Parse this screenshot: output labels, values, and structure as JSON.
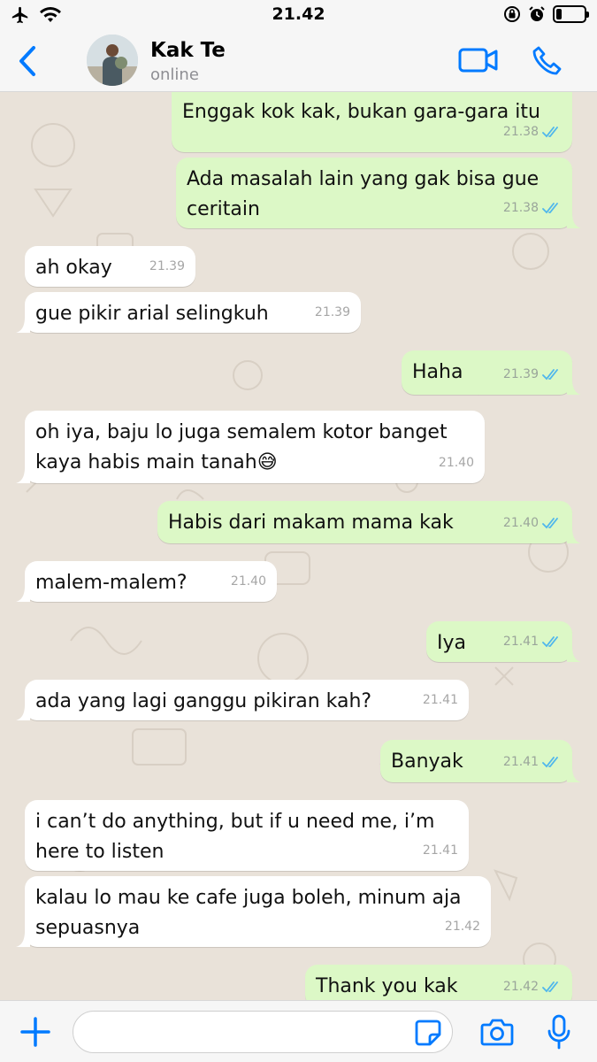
{
  "status_bar": {
    "time": "21.42",
    "battery_level": 0.2
  },
  "header": {
    "contact_name": "Kak Te",
    "contact_status": "online"
  },
  "messages": [
    {
      "direction": "out",
      "text": "Enggak kok kak, bukan gara-gara itu",
      "time": "21.38",
      "read": true
    },
    {
      "direction": "out",
      "text": "Ada masalah lain yang gak bisa gue\nceritain",
      "time": "21.38",
      "read": true
    },
    {
      "direction": "in",
      "text": "ah okay",
      "time": "21.39"
    },
    {
      "direction": "in",
      "text": "gue pikir arial selingkuh",
      "time": "21.39"
    },
    {
      "direction": "out",
      "text": "Haha",
      "time": "21.39",
      "read": true
    },
    {
      "direction": "in",
      "text": "oh iya, baju lo juga semalem kotor banget\nkaya habis main tanah😅",
      "time": "21.40"
    },
    {
      "direction": "out",
      "text": "Habis dari makam mama kak",
      "time": "21.40",
      "read": true
    },
    {
      "direction": "in",
      "text": "malem-malem?",
      "time": "21.40"
    },
    {
      "direction": "out",
      "text": "Iya",
      "time": "21.41",
      "read": true
    },
    {
      "direction": "in",
      "text": "ada yang lagi ganggu pikiran kah?",
      "time": "21.41"
    },
    {
      "direction": "out",
      "text": "Banyak",
      "time": "21.41",
      "read": true
    },
    {
      "direction": "in",
      "text": "i can’t do anything, but if u need me, i’m\nhere to listen",
      "time": "21.41"
    },
    {
      "direction": "in",
      "text": "kalau lo mau ke cafe juga boleh, minum aja\nsepuasnya",
      "time": "21.42"
    },
    {
      "direction": "out",
      "text": "Thank you kak",
      "time": "21.42",
      "read": true
    }
  ],
  "composer": {
    "value": "",
    "placeholder": ""
  },
  "colors": {
    "accent": "#007aff",
    "outgoing_bubble": "#dcf8c6",
    "incoming_bubble": "#ffffff",
    "chat_background": "#e9e2d9",
    "read_ticks": "#4fb6ec"
  },
  "icons": {
    "status_left": [
      "airplane-icon",
      "wifi-icon"
    ],
    "status_right": [
      "orientation-lock-icon",
      "alarm-icon",
      "battery-icon"
    ],
    "header": [
      "back-chevron-icon",
      "video-call-icon",
      "phone-call-icon"
    ],
    "composer": [
      "plus-icon",
      "sticker-icon",
      "camera-icon",
      "mic-icon"
    ]
  }
}
